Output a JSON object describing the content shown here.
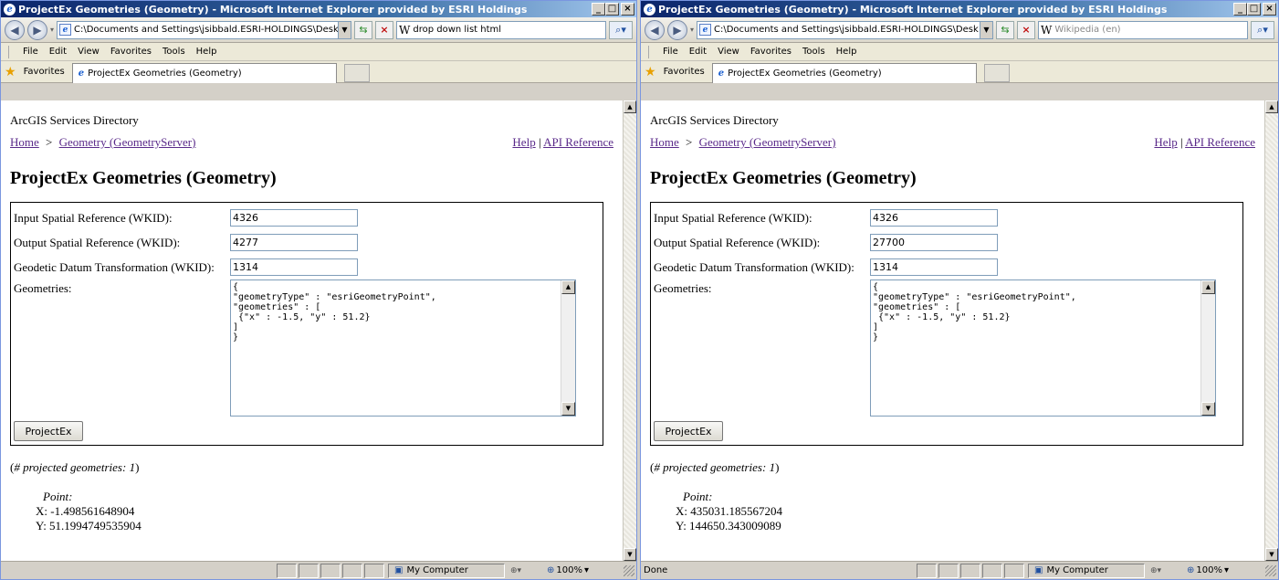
{
  "windows": [
    {
      "title": "ProjectEx Geometries (Geometry) - Microsoft Internet Explorer provided by ESRI Holdings",
      "address": "C:\\Documents and Settings\\jsibbald.ESRI-HOLDINGS\\Desk",
      "search": {
        "text": "drop down list html",
        "placeholder": ""
      },
      "menu": [
        "File",
        "Edit",
        "View",
        "Favorites",
        "Tools",
        "Help"
      ],
      "favorites_label": "Favorites",
      "tab_label": "ProjectEx Geometries (Geometry)",
      "page": {
        "directory_title": "ArcGIS Services Directory",
        "breadcrumb_home": "Home",
        "breadcrumb_sep": ">",
        "breadcrumb_geometry": "Geometry (GeometryServer)",
        "help": "Help",
        "pipe": "|",
        "api_reference": "API Reference",
        "page_title": "ProjectEx Geometries (Geometry)",
        "input_sr_label": "Input Spatial Reference (WKID):",
        "input_sr_value": "4326",
        "output_sr_label": "Output Spatial Reference (WKID):",
        "output_sr_value": "4277",
        "datum_label": "Geodetic Datum Transformation (WKID):",
        "datum_value": "1314",
        "geometries_label": "Geometries:",
        "geometries_value": "{\n\"geometryType\" : \"esriGeometryPoint\",\n\"geometries\" : [\n {\"x\" : -1.5, \"y\" : 51.2}\n]\n}",
        "button": "ProjectEx",
        "count_prefix": "(",
        "count_label": "# projected geometries: 1",
        "count_suffix": ")",
        "point_label": "Point:",
        "x": "X: -1.498561648904",
        "y": "Y: 51.1994749535904"
      },
      "status": {
        "text": "",
        "zone": "My Computer",
        "zoom": "100%"
      }
    },
    {
      "title": "ProjectEx Geometries (Geometry) - Microsoft Internet Explorer provided by ESRI Holdings",
      "address": "C:\\Documents and Settings\\jsibbald.ESRI-HOLDINGS\\Desk",
      "search": {
        "text": "",
        "placeholder": "Wikipedia (en)"
      },
      "menu": [
        "File",
        "Edit",
        "View",
        "Favorites",
        "Tools",
        "Help"
      ],
      "favorites_label": "Favorites",
      "tab_label": "ProjectEx Geometries (Geometry)",
      "page": {
        "directory_title": "ArcGIS Services Directory",
        "breadcrumb_home": "Home",
        "breadcrumb_sep": ">",
        "breadcrumb_geometry": "Geometry (GeometryServer)",
        "help": "Help",
        "pipe": "|",
        "api_reference": "API Reference",
        "page_title": "ProjectEx Geometries (Geometry)",
        "input_sr_label": "Input Spatial Reference (WKID):",
        "input_sr_value": "4326",
        "output_sr_label": "Output Spatial Reference (WKID):",
        "output_sr_value": "27700",
        "datum_label": "Geodetic Datum Transformation (WKID):",
        "datum_value": "1314",
        "geometries_label": "Geometries:",
        "geometries_value": "{\n\"geometryType\" : \"esriGeometryPoint\",\n\"geometries\" : [\n {\"x\" : -1.5, \"y\" : 51.2}\n]\n}",
        "button": "ProjectEx",
        "count_prefix": "(",
        "count_label": "# projected geometries: 1",
        "count_suffix": ")",
        "point_label": "Point:",
        "x": "X: 435031.185567204",
        "y": "Y: 144650.343009089"
      },
      "status": {
        "text": "Done",
        "zone": "My Computer",
        "zoom": "100%"
      }
    }
  ],
  "colors": {
    "titlebar": "#0a246a",
    "visited_link": "#5a2a8a",
    "chrome": "#d4d0c8"
  }
}
